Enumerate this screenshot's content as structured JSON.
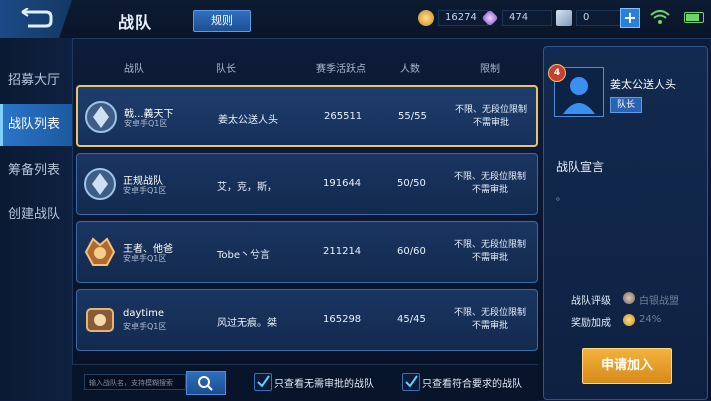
{
  "header": {
    "title": "战队",
    "rules_label": "规则",
    "gold": "16274",
    "diamonds": "474",
    "vouchers": "0",
    "plus_label": "+"
  },
  "sidebar": {
    "items": [
      {
        "label": "招募大厅"
      },
      {
        "label": "战队列表"
      },
      {
        "label": "筹备列表"
      },
      {
        "label": "创建战队"
      }
    ]
  },
  "table": {
    "columns": [
      "战队",
      "队长",
      "赛季活跃点",
      "人数",
      "限制"
    ],
    "rows": [
      {
        "name": "戟...義天下",
        "server": "安卓手Q1区",
        "captain": "姜太公送人头",
        "activity": "265511",
        "members": "55/55",
        "restrict1": "不限、无段位限制",
        "restrict2": "不需审批"
      },
      {
        "name": "正规战队",
        "server": "安卓手Q1区",
        "captain": "艾，克，斯，",
        "activity": "191644",
        "members": "50/50",
        "restrict1": "不限、无段位限制",
        "restrict2": "不需审批"
      },
      {
        "name": "王者、他爸",
        "server": "安卓手Q1区",
        "captain": "Tobe丶兮言",
        "activity": "211214",
        "members": "60/60",
        "restrict1": "不限、无段位限制",
        "restrict2": "不需审批"
      },
      {
        "name": "daytime",
        "server": "安卓手Q1区",
        "captain": "风过无痕。桀",
        "activity": "165298",
        "members": "45/45",
        "restrict1": "不限、无段位限制",
        "restrict2": "不需审批"
      }
    ]
  },
  "bottom": {
    "search_placeholder": "输入战队名，支持模糊搜索",
    "filter1_label": "只查看无需审批的战队",
    "filter2_label": "只查看符合要求的战队"
  },
  "panel": {
    "level": "4",
    "leader_name": "姜太公送人头",
    "captain_tag": "队长",
    "declaration_title": "战队宣言",
    "declaration_text": "。",
    "rating_label": "战队评级",
    "rating_value": "白银战盟",
    "bonus_label": "奖励加成",
    "bonus_value": "24%",
    "join_label": "申请加入"
  },
  "colors": {
    "selected_border": "#e7c56a",
    "join_button": "#f3b23c",
    "active_tab": "#2a74c8"
  }
}
